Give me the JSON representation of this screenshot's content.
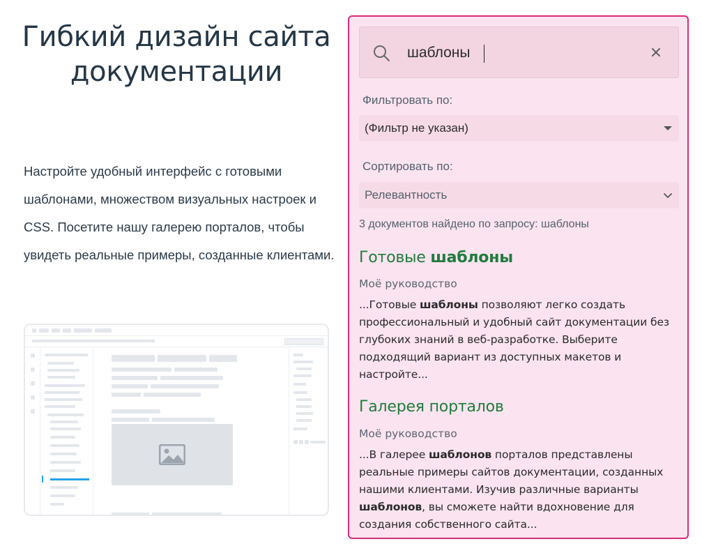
{
  "hero": {
    "title_line1": "Гибкий дизайн сайта",
    "title_line2": "документации",
    "description": "Настройте удобный интерфейс с готовыми шаблонами, множеством визуальных настроек и CSS. Посетите нашу галерею порталов, чтобы увидеть реальные примеры, созданные клиентами."
  },
  "search": {
    "query": "шаблоны",
    "clear_icon": "close-icon",
    "search_icon": "search-icon",
    "accent_color": "#d62c7a",
    "panel_bg": "#fbe4ef"
  },
  "filter": {
    "label": "Фильтровать по:",
    "selected": "(Фильтр не указан)"
  },
  "sort": {
    "label": "Сортировать по:",
    "selected": "Релевантность"
  },
  "results_count": "3 документов найдено по запросу: шаблоны",
  "results": [
    {
      "title_pre": "Готовые ",
      "title_hl": "шаблоны",
      "source": "Моё руководство",
      "snippet": [
        {
          "text": "...Готовые ",
          "bold": false
        },
        {
          "text": "шаблоны",
          "bold": true
        },
        {
          "text": " позволяют легко создать профессиональный и удобный сайт документации без глубоких знаний в веб-разработке. Выберите подходящий вариант из доступных макетов и настройте...",
          "bold": false
        }
      ]
    },
    {
      "title_pre": "Галерея порталов",
      "title_hl": "",
      "source": "Моё руководство",
      "snippet": [
        {
          "text": "...В галерее ",
          "bold": false
        },
        {
          "text": "шаблонов",
          "bold": true
        },
        {
          "text": " порталов представлены реальные примеры сайтов документации, созданных нашими клиентами. Изучив различные варианты ",
          "bold": false
        },
        {
          "text": "шаблонов",
          "bold": true
        },
        {
          "text": ", вы сможете найти вдохновение для создания собственного сайта...",
          "bold": false
        }
      ]
    }
  ],
  "colors": {
    "result_title": "#1f7c3d",
    "text_dark": "#253746"
  }
}
